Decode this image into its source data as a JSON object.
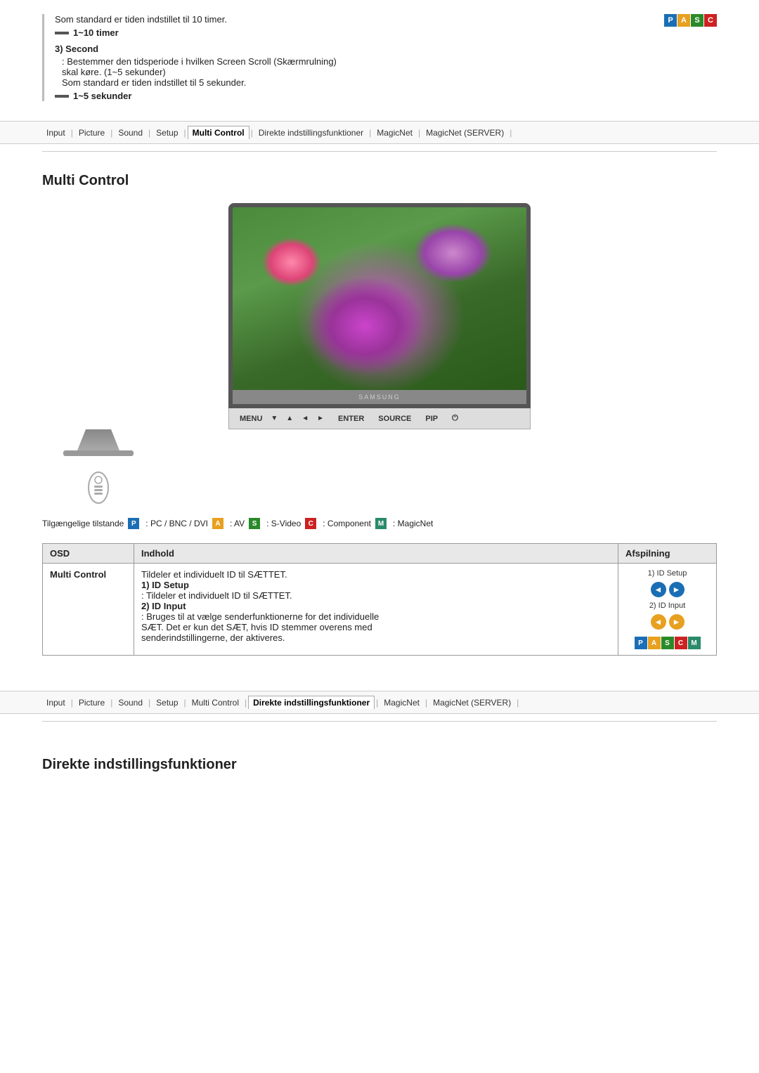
{
  "top": {
    "timer_text": "Som standard er tiden indstillet til 10 timer.",
    "timer_bullet": "1~10 timer",
    "second_title": "3) Second",
    "second_desc1": ": Bestemmer den tidsperiode i hvilken Screen Scroll (Skærmrulning)",
    "second_desc2": "skal køre. (1~5 sekunder)",
    "second_desc3": "Som standard er tiden indstillet til 5 sekunder.",
    "second_bullet": "1~5 sekunder",
    "pasc_letters": [
      "P",
      "A",
      "S",
      "C"
    ]
  },
  "nav1": {
    "items": [
      {
        "label": "Input",
        "active": false
      },
      {
        "label": "Picture",
        "active": false
      },
      {
        "label": "Sound",
        "active": false
      },
      {
        "label": "Setup",
        "active": false
      },
      {
        "label": "Multi Control",
        "active": true
      },
      {
        "label": "Direkte indstillingsfunktioner",
        "active": false
      },
      {
        "label": "MagicNet",
        "active": false
      },
      {
        "label": "MagicNet (SERVER)",
        "active": false
      }
    ]
  },
  "multi_control": {
    "heading": "Multi Control",
    "samsung_label": "SAMSUNG",
    "controls": {
      "menu": "MENU",
      "down": "▼",
      "up": "▲",
      "left": "◄",
      "right": "►",
      "enter": "ENTER",
      "source": "SOURCE",
      "pip": "PIP",
      "power": "⏻"
    },
    "legend_text": "Tilgængelige tilstande",
    "legend_items": [
      {
        "badge": "P",
        "color": "#1a6eb5",
        "label": ": PC / BNC / DVI"
      },
      {
        "badge": "A",
        "color": "#e8a020",
        "label": ": AV"
      },
      {
        "badge": "S",
        "color": "#2a8a2a",
        "label": ": S-Video"
      },
      {
        "badge": "C",
        "color": "#cc2222",
        "label": ": Component"
      },
      {
        "badge": "M",
        "color": "#2a8a6a",
        "label": ": MagicNet"
      }
    ]
  },
  "table": {
    "headers": [
      "OSD",
      "Indhold",
      "Afspilning"
    ],
    "row": {
      "osd": "Multi Control",
      "content_lines": [
        "Tildeler et individuelt ID til SÆTTET.",
        "1) ID Setup",
        ": Tildeler et individuelt ID til SÆTTET.",
        "2) ID Input",
        ": Bruges til at vælge senderfunktionerne for det individuelle",
        "SÆT. Det er kun det SÆT, hvis ID stemmer overens med",
        "senderindstillingerne, der aktiveres."
      ],
      "display_label1": "1) ID Setup",
      "display_label2": "2) ID Input",
      "pasc_letters": [
        "P",
        "A",
        "S",
        "C",
        "M"
      ]
    }
  },
  "nav2": {
    "items": [
      {
        "label": "Input",
        "active": false
      },
      {
        "label": "Picture",
        "active": false
      },
      {
        "label": "Sound",
        "active": false
      },
      {
        "label": "Setup",
        "active": false
      },
      {
        "label": "Multi Control",
        "active": false
      },
      {
        "label": "Direkte indstillingsfunktioner",
        "active": true
      },
      {
        "label": "MagicNet",
        "active": false
      },
      {
        "label": "MagicNet (SERVER)",
        "active": false
      }
    ]
  },
  "direkte": {
    "heading": "Direkte indstillingsfunktioner"
  }
}
